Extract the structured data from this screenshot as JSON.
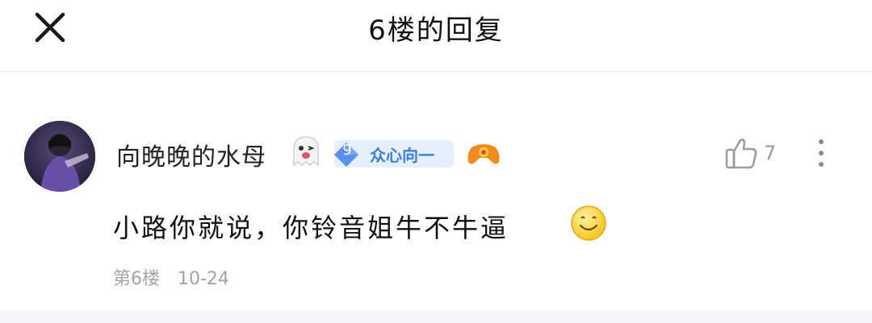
{
  "header": {
    "title": "6楼的回复",
    "close_icon": "close-icon"
  },
  "post": {
    "username": "向晚晚的水母",
    "badge": {
      "level": "9",
      "text": "众心向一",
      "color": "#3c7fe0"
    },
    "icons": [
      "ghost-emoji-icon",
      "gamepad-icon",
      "thumbs-up-icon",
      "more-vertical-icon",
      "smile-emoji-icon"
    ],
    "like_count": "7",
    "content": "小路你就说，你铃音姐牛不牛逼",
    "floor": "第6楼",
    "date": "10-24"
  }
}
